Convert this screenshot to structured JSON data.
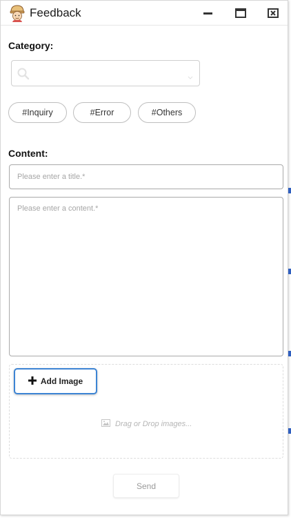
{
  "window": {
    "title": "Feedback",
    "app_icon": "engineer-avatar-icon",
    "controls": [
      "minimize-icon",
      "maximize-icon",
      "close-icon"
    ]
  },
  "category": {
    "label": "Category:",
    "search": {
      "value": "",
      "placeholder": "",
      "icon": "search-icon"
    },
    "tags": [
      "#Inquiry",
      "#Error",
      "#Others"
    ]
  },
  "content": {
    "label": "Content:",
    "title_placeholder": "Please enter a title.*",
    "body_placeholder": "Please enter a content.*"
  },
  "attachments": {
    "add_button": "Add Image",
    "drop_hint": "Drag or Drop images..."
  },
  "actions": {
    "send": "Send"
  },
  "colors": {
    "accent": "#3c84d4",
    "border": "#a9a9a9",
    "muted_text": "#a6a6a6"
  }
}
